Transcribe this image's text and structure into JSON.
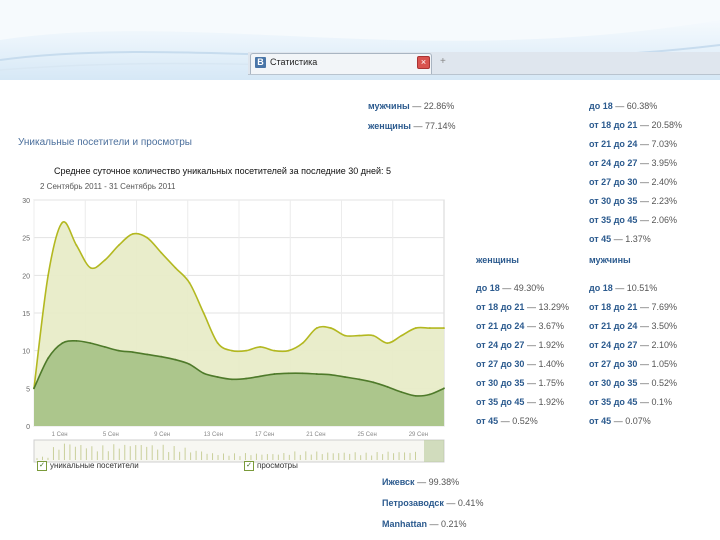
{
  "browser": {
    "tab_title": "Статистика",
    "close_label": "×",
    "new_tab_label": "+",
    "favicon_letter": "В"
  },
  "left_panel": {
    "title": "Уникальные посетители и просмотры",
    "caption": "Среднее суточное количество уникальных посетителей за последние 30 дней: 5",
    "date_range": "2 Сентябрь 2011 - 31 Сентябрь 2011",
    "legend": [
      {
        "label": "уникальные посетители",
        "checked": true
      },
      {
        "label": "просмотры",
        "checked": true
      }
    ]
  },
  "gender_totals": [
    {
      "key": "мужчины",
      "value": "— 22.86%"
    },
    {
      "key": "женщины",
      "value": "— 77.14%"
    }
  ],
  "age_all": [
    {
      "key": "до 18",
      "value": "— 60.38%"
    },
    {
      "key": "от 18 до 21",
      "value": "— 20.58%"
    },
    {
      "key": "от 21 до 24",
      "value": "— 7.03%"
    },
    {
      "key": "от 24 до 27",
      "value": "— 3.95%"
    },
    {
      "key": "от 27 до 30",
      "value": "— 2.40%"
    },
    {
      "key": "от 30 до 35",
      "value": "— 2.23%"
    },
    {
      "key": "от 35 до 45",
      "value": "— 2.06%"
    },
    {
      "key": "от 45",
      "value": "— 1.37%"
    }
  ],
  "women_header": "женщины",
  "men_header": "мужчины",
  "women_age": [
    {
      "key": "до 18",
      "value": "— 49.30%"
    },
    {
      "key": "от 18 до 21",
      "value": "— 13.29%"
    },
    {
      "key": "от 21 до 24",
      "value": "— 3.67%"
    },
    {
      "key": "от 24 до 27",
      "value": "— 1.92%"
    },
    {
      "key": "от 27 до 30",
      "value": "— 1.40%"
    },
    {
      "key": "от 30 до 35",
      "value": "— 1.75%"
    },
    {
      "key": "от 35 до 45",
      "value": "— 1.92%"
    },
    {
      "key": "от 45",
      "value": "— 0.52%"
    }
  ],
  "men_age": [
    {
      "key": "до 18",
      "value": "— 10.51%"
    },
    {
      "key": "от 18 до 21",
      "value": "— 7.69%"
    },
    {
      "key": "от 21 до 24",
      "value": "— 3.50%"
    },
    {
      "key": "от 24 до 27",
      "value": "— 2.10%"
    },
    {
      "key": "от 27 до 30",
      "value": "— 1.05%"
    },
    {
      "key": "от 30 до 35",
      "value": "— 0.52%"
    },
    {
      "key": "от 35 до 45",
      "value": "— 0.1%"
    },
    {
      "key": "от 45",
      "value": "— 0.07%"
    }
  ],
  "cities": [
    {
      "key": "Ижевск",
      "value": "— 99.38%"
    },
    {
      "key": "Петрозаводск",
      "value": "— 0.41%"
    },
    {
      "key": "Manhattan",
      "value": "— 0.21%"
    }
  ],
  "colors": {
    "views_fill": "#e8ecc8",
    "views_line": "#b3b820",
    "visitors_fill": "#a9c488",
    "visitors_line": "#4e7a2a",
    "link": "#2b5a8e"
  },
  "chart_data": {
    "type": "area",
    "ylim": [
      0,
      30
    ],
    "y_ticks": [
      "30",
      "25",
      "20",
      "15",
      "10",
      "5",
      "0"
    ],
    "x_ticks": [
      "1 Сен",
      "5 Сен",
      "9 Сен",
      "13 Сен",
      "17 Сен",
      "21 Сен",
      "25 Сен",
      "29 Сен"
    ],
    "x": [
      1,
      2,
      3,
      4,
      5,
      6,
      7,
      8,
      9,
      10,
      11,
      12,
      13,
      14,
      15,
      16,
      17,
      18,
      19,
      20,
      21,
      22,
      23,
      24,
      25,
      26,
      27,
      28,
      29,
      30
    ],
    "series": [
      {
        "values": [
          5,
          20,
          27,
          24,
          21,
          22,
          24,
          25.5,
          25,
          23,
          21,
          19,
          15,
          11,
          10,
          10,
          10.5,
          10,
          10,
          11,
          13,
          13,
          12,
          12,
          12,
          11,
          12,
          13,
          13,
          13
        ]
      },
      {
        "values": [
          5,
          9,
          11,
          11.3,
          11,
          10.5,
          10,
          9.8,
          9.5,
          9.2,
          8.8,
          8.2,
          7,
          6.5,
          6.2,
          6.3,
          6.6,
          6.9,
          7,
          7,
          6.9,
          6.8,
          6.5,
          6.2,
          5.8,
          5.2,
          4.5,
          4,
          4.2,
          5
        ]
      }
    ]
  }
}
